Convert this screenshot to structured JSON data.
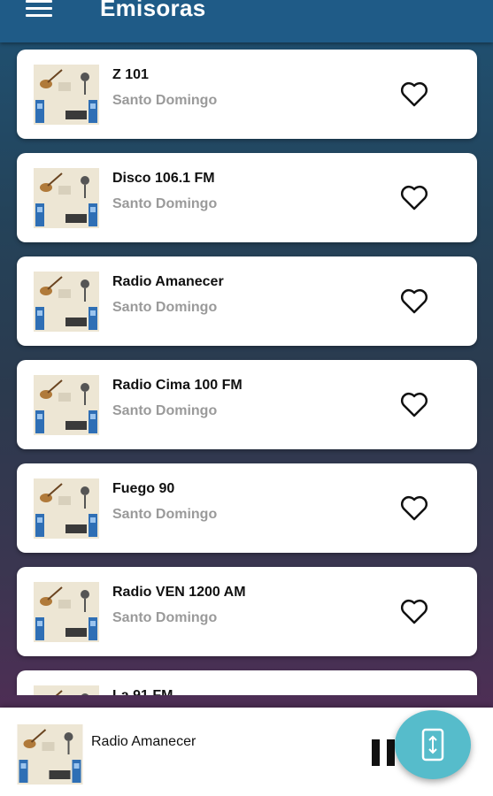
{
  "app_bar": {
    "title": "Emisoras",
    "menu_icon": "menu-icon"
  },
  "stations": [
    {
      "name": "Z 101",
      "city": "Santo Domingo",
      "favorite_icon": "heart-outline-icon"
    },
    {
      "name": "Disco 106.1 FM",
      "city": "Santo Domingo",
      "favorite_icon": "heart-outline-icon"
    },
    {
      "name": "Radio Amanecer",
      "city": "Santo Domingo",
      "favorite_icon": "heart-outline-icon"
    },
    {
      "name": "Radio Cima 100 FM",
      "city": "Santo Domingo",
      "favorite_icon": "heart-outline-icon"
    },
    {
      "name": "Fuego 90",
      "city": "Santo Domingo",
      "favorite_icon": "heart-outline-icon"
    },
    {
      "name": "Radio VEN 1200 AM",
      "city": "Santo Domingo",
      "favorite_icon": "heart-outline-icon"
    },
    {
      "name": "La 91 FM",
      "city": "",
      "favorite_icon": "heart-outline-icon"
    }
  ],
  "player": {
    "now_playing": "Radio Amanecer",
    "control_icon": "pause-icon"
  },
  "fab": {
    "icon": "expand-vertical-icon"
  },
  "colors": {
    "app_bar": "#1f5b87",
    "fab": "#56bccb",
    "city_text": "#9a9a9a"
  }
}
